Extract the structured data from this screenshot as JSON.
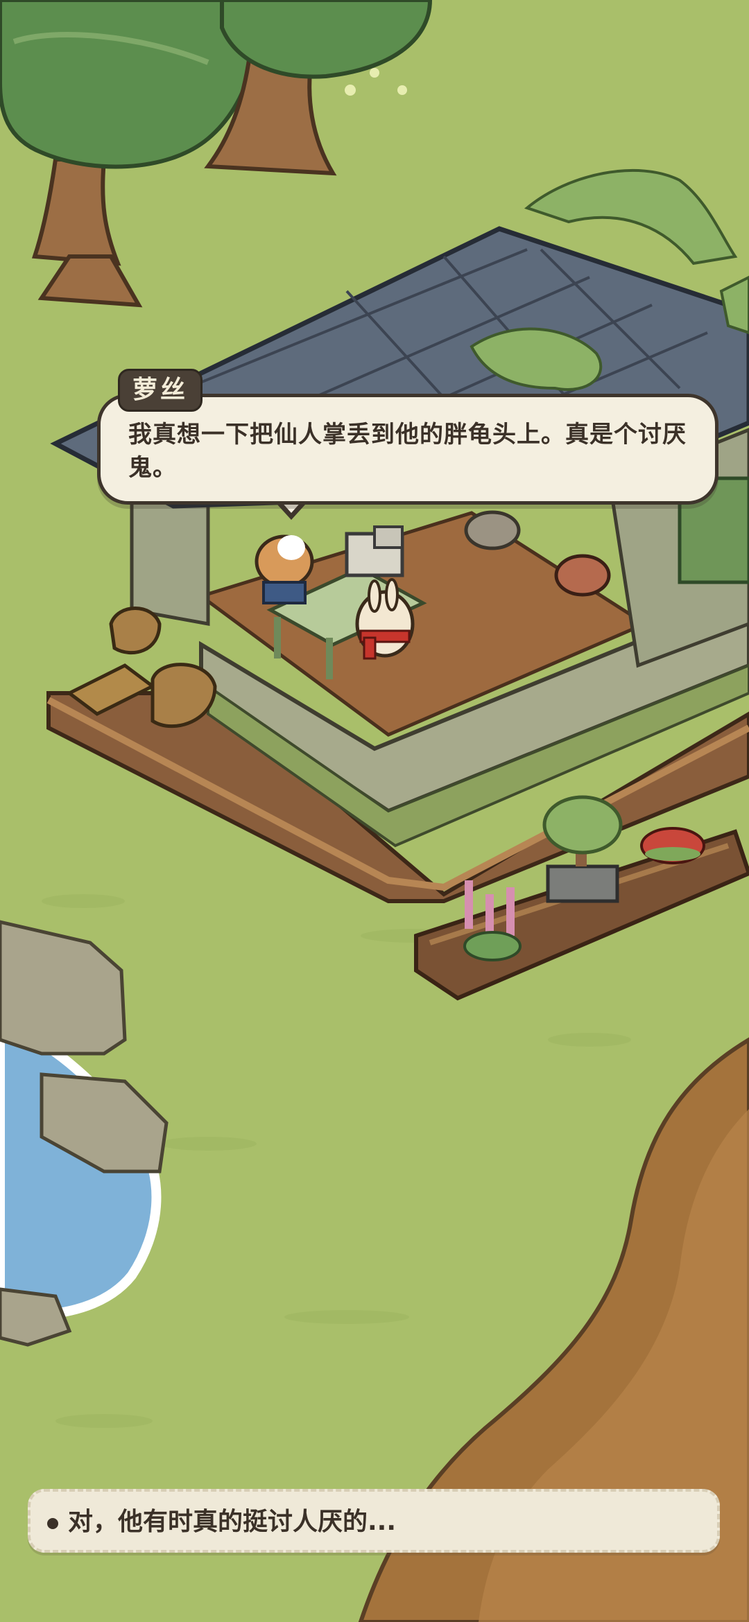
{
  "dialogue": {
    "speaker": "萝丝",
    "text": "我真想一下把仙人掌丢到他的胖龟头上。真是个讨厌鬼。"
  },
  "choices": [
    {
      "label": "对，他有时真的挺讨人厌的..."
    }
  ],
  "colors": {
    "grass": "#a9bf6a",
    "roof": "#5e6b7c",
    "wood_floor": "#8a5e3c",
    "water": "#7fb2d8",
    "path": "#a4733c",
    "bubble": "#f4efe0"
  }
}
